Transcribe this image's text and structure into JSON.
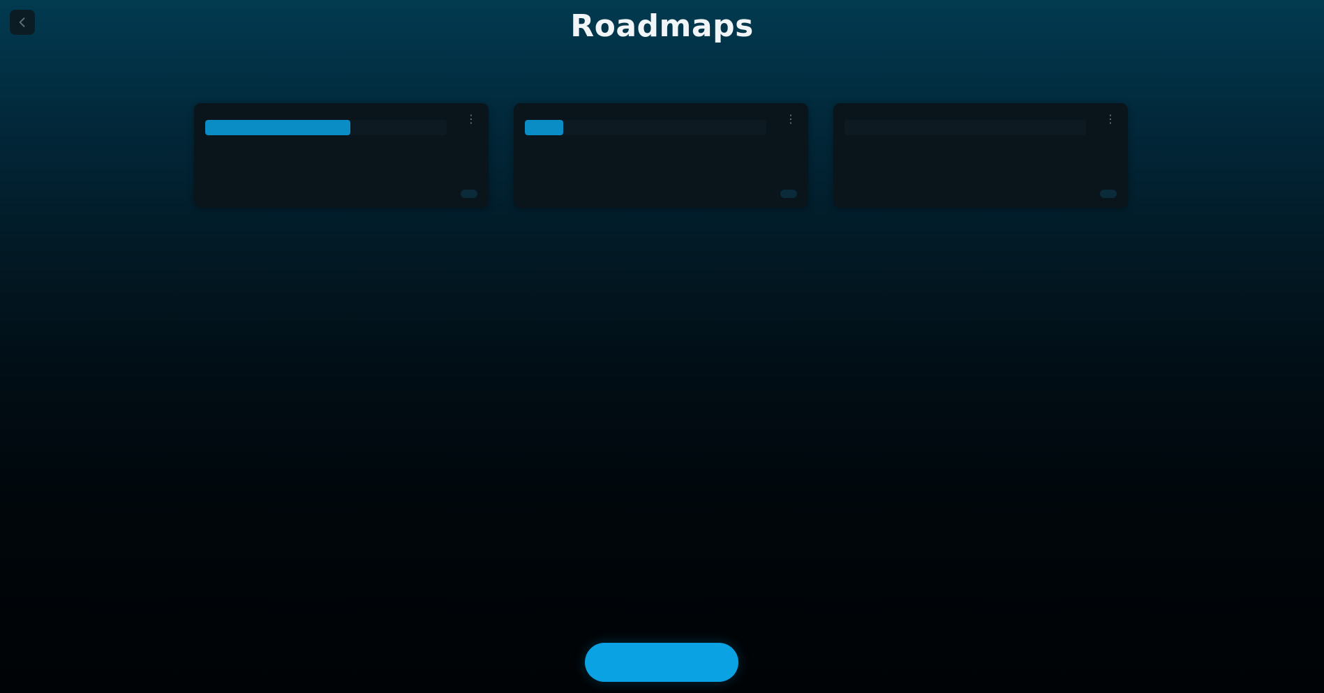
{
  "page": {
    "title": "Roadmaps",
    "subtitle": "",
    "back_icon": "arrow-left-icon"
  },
  "colors": {
    "accent": "#0ba2e4",
    "progress": "#0a8cc4",
    "status_blue": "#1aa0d8",
    "status_orange": "#e09b2a",
    "card_bg": "#0a141b"
  },
  "roadmaps": [
    {
      "title": "",
      "status": "",
      "status_color": "#1aa0d8",
      "progress": 0.6,
      "progress_label": "",
      "meta": "",
      "action_label": ""
    },
    {
      "title": "",
      "status": "",
      "status_color": "#1aa0d8",
      "progress": 0.16,
      "progress_label": "",
      "meta": "",
      "action_label": ""
    },
    {
      "title": "",
      "status": "",
      "status_color": "#e09b2a",
      "progress": 0.0,
      "progress_label": "",
      "meta": "",
      "action_label": ""
    }
  ],
  "primary_action": {
    "label": ""
  }
}
